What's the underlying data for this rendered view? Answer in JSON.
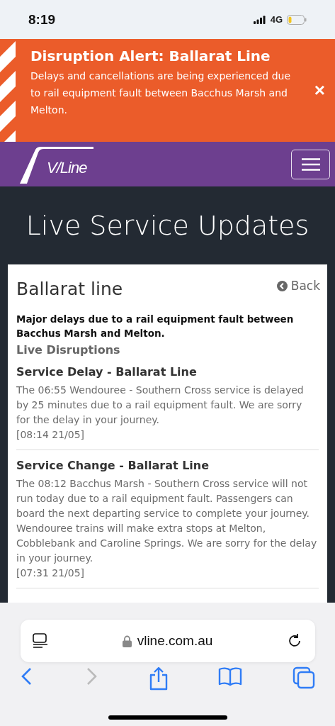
{
  "status_bar": {
    "time": "8:19",
    "network": "4G"
  },
  "alert": {
    "title": "Disruption Alert: Ballarat Line",
    "message": "Delays and cancellations are being experienced due to rail equipment fault between Bacchus Marsh and Melton.",
    "close": "×"
  },
  "nav": {
    "logo": "V/Line"
  },
  "page_title": "Live Service Updates",
  "card": {
    "title": "Ballarat line",
    "back": "Back",
    "summary": "Major delays due to a rail equipment fault between Bacchus Marsh and Melton.",
    "section": "Live Disruptions",
    "updates": [
      {
        "title": "Service Delay - Ballarat Line",
        "body": "The 06:55 Wendouree - Southern Cross service is delayed by 25 minutes due to a rail equipment fault. We are sorry for the delay in your journey.",
        "stamp": "[08:14 21/05]"
      },
      {
        "title": "Service Change - Ballarat Line",
        "body": "The 08:12 Bacchus Marsh - Southern Cross service will not run today due to a rail equipment fault. Passengers can board the next departing service to complete your journey. Wendouree trains will make extra stops at Melton, Cobblebank and Caroline Springs. We are sorry for the delay in your journey.",
        "stamp": "[07:31 21/05]"
      }
    ]
  },
  "browser": {
    "url": "vline.com.au",
    "forward_disabled": true
  }
}
